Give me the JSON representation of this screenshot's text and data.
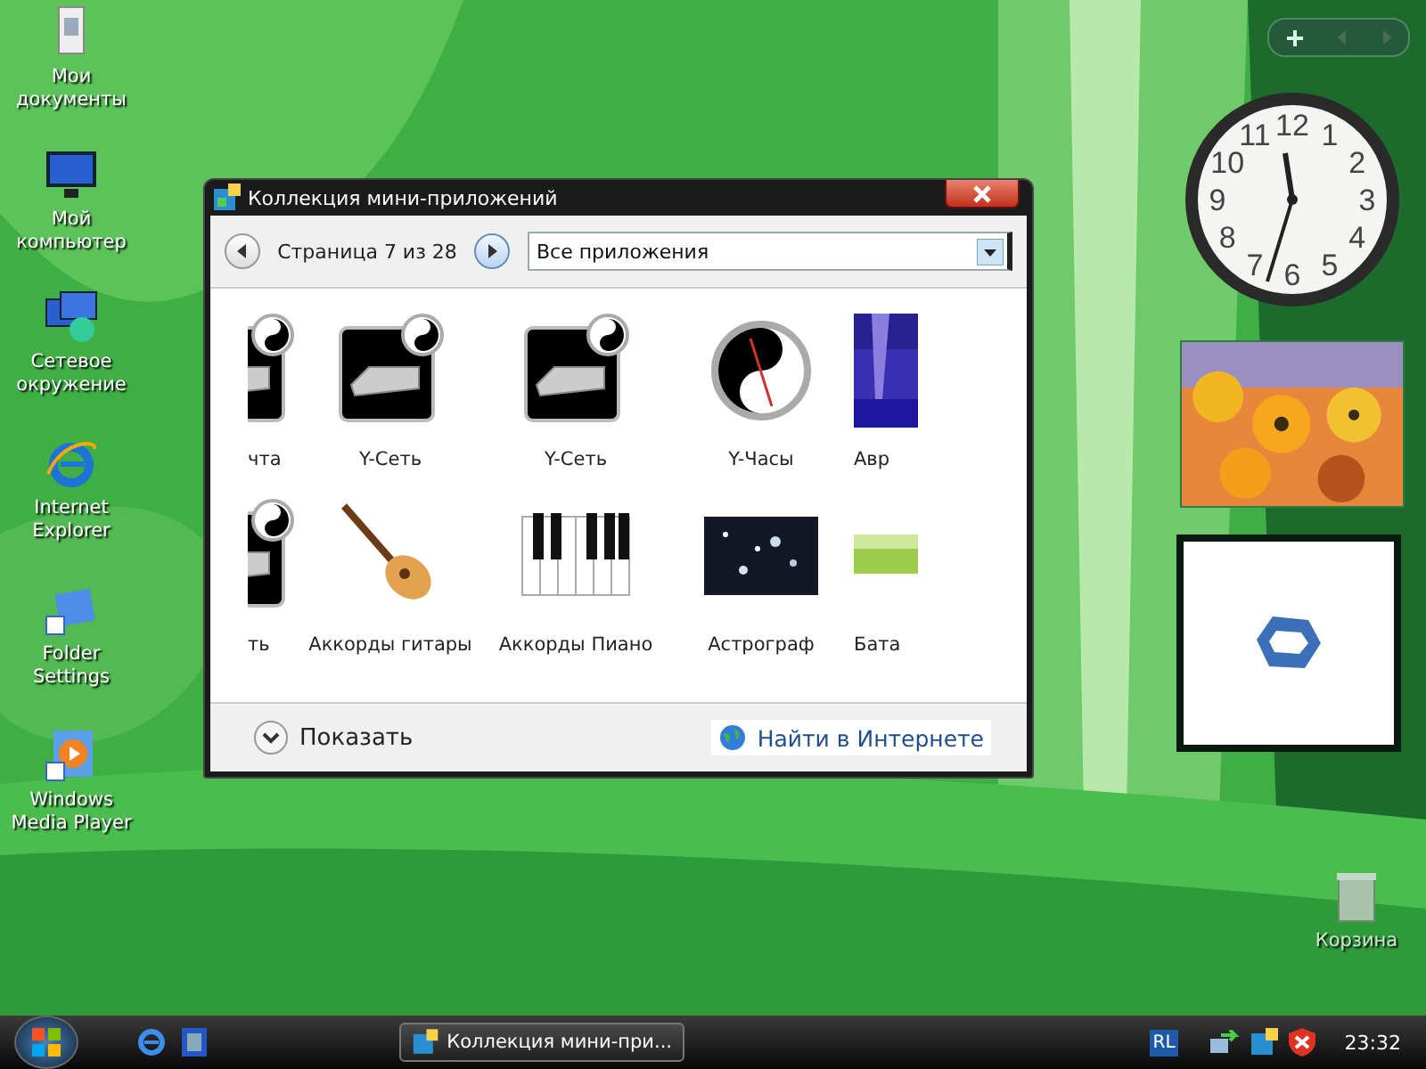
{
  "desktop_icons": [
    {
      "label": "Мои документы"
    },
    {
      "label": "Мой компьютер"
    },
    {
      "label": "Сетевое окружение"
    },
    {
      "label": "Internet Explorer"
    },
    {
      "label": "Folder Settings"
    },
    {
      "label": "Windows Media Player"
    }
  ],
  "gallery_window": {
    "title": "Коллекция мини-приложений",
    "page_label": "Страница 7 из 28",
    "filter": "Все приложения",
    "gadgets": [
      {
        "label": "чта"
      },
      {
        "label": "Y-Сеть"
      },
      {
        "label": "Y-Сеть"
      },
      {
        "label": "Y-Часы"
      },
      {
        "label": "Авр"
      },
      {
        "label": "ть"
      },
      {
        "label": "Аккорды гитары"
      },
      {
        "label": "Аккорды Пиано"
      },
      {
        "label": "Астрограф"
      },
      {
        "label": "Бата"
      }
    ],
    "show_details": "Показать",
    "online_link": "Найти в Интернете"
  },
  "sidebar": {
    "clock_numerals": [
      "11",
      "12",
      "1",
      "10",
      "2",
      "9",
      "3",
      "8",
      "4",
      "7",
      "6",
      "5"
    ]
  },
  "recycle_bin": "Корзина",
  "taskbar": {
    "task_title": "Коллекция мини-при...",
    "tray_language": "RL",
    "time": "23:32"
  }
}
